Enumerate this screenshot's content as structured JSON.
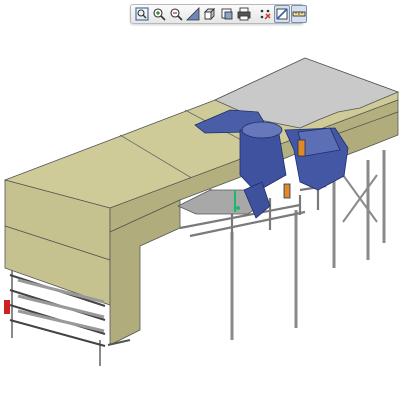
{
  "toolbar": {
    "buttons": [
      {
        "name": "fit-all-icon"
      },
      {
        "name": "zoom-in-icon"
      },
      {
        "name": "zoom-out-icon"
      },
      {
        "name": "normal-view-icon"
      },
      {
        "name": "view-cube-icon"
      },
      {
        "name": "render-style-icon"
      },
      {
        "name": "print-icon"
      },
      {
        "name": "hide-show-icon"
      },
      {
        "name": "cut-section-icon",
        "active": true
      },
      {
        "name": "measure-icon",
        "active": true
      }
    ]
  },
  "model": {
    "panel_color": "#c9c592",
    "panel_side_color": "#b3ae7c",
    "roof_gray": "#c4c4c4",
    "frame_color": "#9b9b9b",
    "blue_equipment": "#4a5ea8",
    "orange_accent": "#e08a22",
    "red_accent": "#cc2222"
  }
}
